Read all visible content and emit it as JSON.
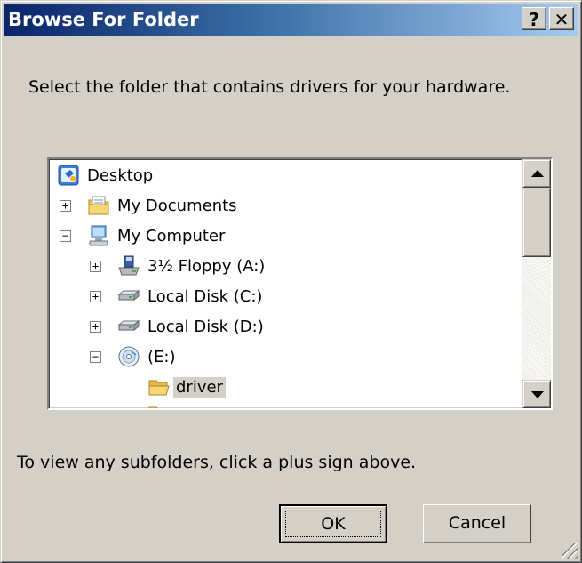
{
  "window": {
    "title": "Browse For Folder",
    "help_label": "?",
    "close_label": "✕"
  },
  "prompt": "Select the folder that contains drivers for your hardware.",
  "tree": {
    "items": [
      {
        "label": "Desktop",
        "icon": "desktop-icon",
        "expander": ""
      },
      {
        "label": "My Documents",
        "icon": "documents-folder-icon",
        "expander": "+"
      },
      {
        "label": "My Computer",
        "icon": "computer-icon",
        "expander": "−"
      },
      {
        "label": "3½ Floppy (A:)",
        "icon": "floppy-drive-icon",
        "expander": "+"
      },
      {
        "label": "Local Disk (C:)",
        "icon": "hard-disk-icon",
        "expander": "+"
      },
      {
        "label": "Local Disk (D:)",
        "icon": "hard-disk-icon",
        "expander": "+"
      },
      {
        "label": "(E:)",
        "icon": "cd-drive-icon",
        "expander": "−"
      },
      {
        "label": "driver",
        "icon": "open-folder-icon",
        "expander": "",
        "selected": true
      }
    ]
  },
  "hint": "To view any subfolders, click a plus sign above.",
  "buttons": {
    "ok_label": "OK",
    "cancel_label": "Cancel"
  },
  "colors": {
    "title_start": "#0a246a",
    "title_end": "#a6caf0",
    "face": "#d4d0c8"
  }
}
